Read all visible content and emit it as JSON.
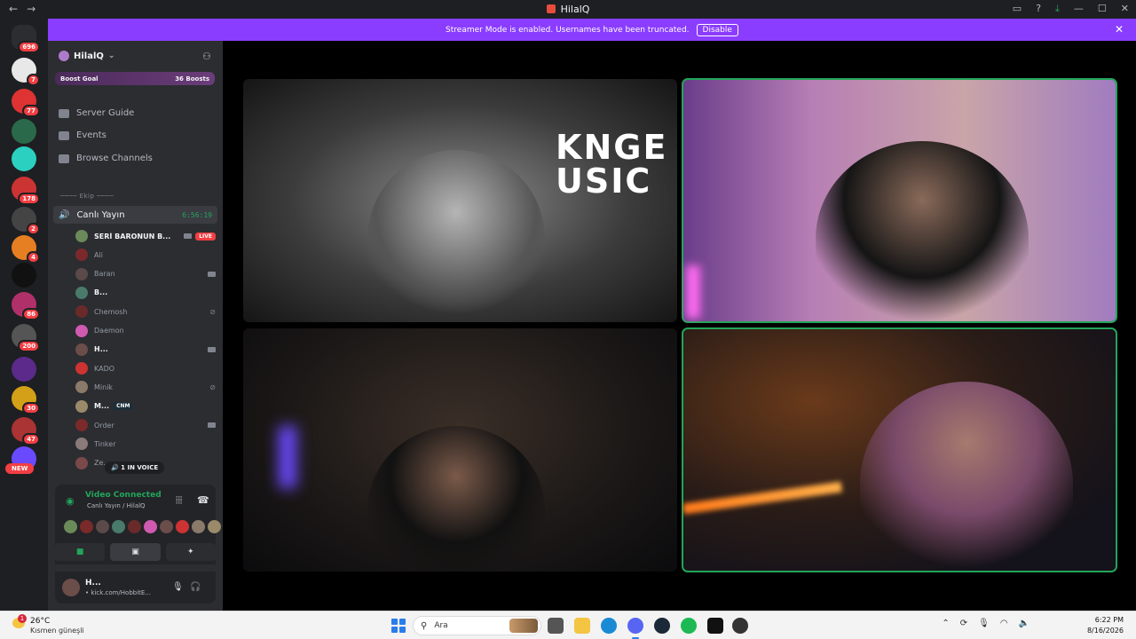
{
  "window": {
    "title": "HilalQ",
    "back_glyph": "←",
    "forward_glyph": "→",
    "controls": [
      "inbox-icon",
      "help-icon",
      "download-icon",
      "minimize",
      "maximize",
      "close"
    ]
  },
  "guilds": [
    {
      "name": "direct-messages",
      "badge": "696",
      "color": "#2b2d31"
    },
    {
      "name": "guild-1",
      "badge": "7",
      "color": "#e8e8e8"
    },
    {
      "name": "guild-2",
      "badge": "77",
      "color": "#d33"
    },
    {
      "name": "guild-3",
      "badge": "",
      "color": "#2a6a4a"
    },
    {
      "name": "guild-4",
      "badge": "",
      "color": "#2bd0c0"
    },
    {
      "name": "guild-5",
      "badge": "178",
      "color": "#c33"
    },
    {
      "name": "guild-6",
      "badge": "2",
      "color": "#444"
    },
    {
      "name": "guild-7",
      "badge": "4",
      "color": "#e67e22"
    },
    {
      "name": "guild-8",
      "badge": "",
      "color": "#111"
    },
    {
      "name": "guild-9",
      "badge": "86",
      "color": "#b0306a"
    },
    {
      "name": "guild-10",
      "badge": "200",
      "color": "#555"
    },
    {
      "name": "guild-folder",
      "badge": "",
      "color": "#5b2a8a"
    },
    {
      "name": "guild-11",
      "badge": "30",
      "color": "#d4a017"
    },
    {
      "name": "guild-12",
      "badge": "47",
      "color": "#a33"
    },
    {
      "name": "guild-13",
      "badge": "",
      "color": "#6a4aff"
    }
  ],
  "new_label": "NEW",
  "streamer_mode": {
    "message": "Streamer Mode is enabled. Usernames have been truncated.",
    "button": "Disable",
    "close_glyph": "✕"
  },
  "server": {
    "name": "HilalQ",
    "boost_goal": "Boost Goal",
    "boosts": "36 Boosts",
    "nav": [
      "Server Guide",
      "Events",
      "Browse Channels"
    ],
    "category": "──── Ekip ────",
    "voice_channel": "Canlı Yayın",
    "elapsed": "6:56:19",
    "members": [
      {
        "name": "SERİ BARONUN B...",
        "bold": true,
        "live": "LIVE",
        "cam": true,
        "color": "#6a8a5a"
      },
      {
        "name": "Ali",
        "bold": false,
        "color": "#7a2a2a"
      },
      {
        "name": "Baran",
        "bold": false,
        "cam": true,
        "color": "#5a4a4a"
      },
      {
        "name": "B...",
        "bold": true,
        "color": "#4a7a6a"
      },
      {
        "name": "Chemosh",
        "bold": false,
        "muted": true,
        "color": "#6a2a2a"
      },
      {
        "name": "Daemon",
        "bold": false,
        "color": "#d05ab0"
      },
      {
        "name": "H...",
        "bold": true,
        "cam": true,
        "color": "#6b4d4a"
      },
      {
        "name": "KADO",
        "bold": false,
        "color": "#c33"
      },
      {
        "name": "Minik",
        "bold": false,
        "muted": true,
        "color": "#8a7a6a"
      },
      {
        "name": "M...",
        "bold": true,
        "tag": "CNM",
        "color": "#9a8a6a"
      },
      {
        "name": "Order",
        "bold": false,
        "cam": true,
        "color": "#7a2a2a"
      },
      {
        "name": "Tinker",
        "bold": false,
        "color": "#8a7a7a"
      },
      {
        "name": "Ze...",
        "bold": false,
        "color": "#7a4a4a"
      }
    ],
    "in_voice": "1 IN VOICE"
  },
  "rtc": {
    "status": "Video Connected",
    "location": "Canlı Yayın / HilalQ",
    "avatars": [
      "#6a8a5a",
      "#7a2a2a",
      "#5a4a4a",
      "#4a7a6a",
      "#6a2a2a",
      "#d05ab0",
      "#6b4d4a",
      "#c33",
      "#8a7a6a",
      "#9a8a6a"
    ]
  },
  "user": {
    "name": "H...",
    "status": "• kick.com/HobbitE..."
  },
  "stage": {
    "tile1_text": "KNGE\nUSIC"
  },
  "taskbar": {
    "notification_count": "1",
    "temperature": "26°C",
    "condition": "Kısmen güneşli",
    "search_placeholder": "Ara",
    "time": "6:22 PM",
    "date": "8/16/2026"
  }
}
